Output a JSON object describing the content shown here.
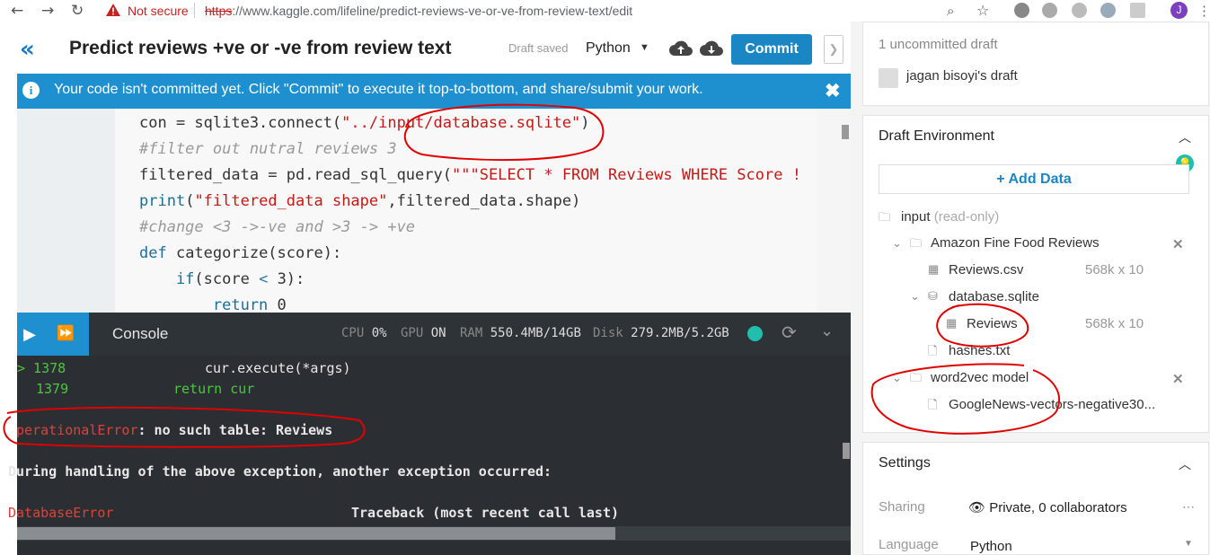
{
  "browser": {
    "security_text": "Not secure",
    "url_scheme": "https",
    "url_rest": "://www.kaggle.com/lifeline/predict-reviews-ve-or-ve-from-review-text/edit",
    "user_initial": "J"
  },
  "header": {
    "title": "Predict reviews +ve or -ve from review text",
    "draft_status": "Draft saved",
    "language": "Python",
    "commit_label": "Commit"
  },
  "banner": {
    "text": "Your code isn't committed yet. Click \"Commit\" to execute it top-to-bottom, and share/submit your work."
  },
  "code_lines": [
    [
      {
        "t": "con = sqlite3.connect(",
        "c": ""
      },
      {
        "t": "\"../input/database.sqlite\"",
        "c": "str"
      },
      {
        "t": ")",
        "c": ""
      }
    ],
    [
      {
        "t": "#filter out nutral reviews 3",
        "c": "cmt"
      }
    ],
    [
      {
        "t": "filtered_data = pd.read_sql_query(",
        "c": ""
      },
      {
        "t": "\"\"\"SELECT * FROM Reviews WHERE Score !",
        "c": "str"
      }
    ],
    [
      {
        "t": "print",
        "c": "kw"
      },
      {
        "t": "(",
        "c": ""
      },
      {
        "t": "\"filtered_data shape\"",
        "c": "str"
      },
      {
        "t": ",filtered_data.shape)",
        "c": ""
      }
    ],
    [
      {
        "t": "#change <3 ->-ve and >3 -> +ve",
        "c": "cmt"
      }
    ],
    [
      {
        "t": "def",
        "c": "kw"
      },
      {
        "t": " categorize(score):",
        "c": ""
      }
    ],
    [
      {
        "t": "    if",
        "c": "kw"
      },
      {
        "t": "(score ",
        "c": ""
      },
      {
        "t": "<",
        "c": "op"
      },
      {
        "t": " 3):",
        "c": ""
      }
    ],
    [
      {
        "t": "        return",
        "c": "kw"
      },
      {
        "t": " 0",
        "c": ""
      }
    ]
  ],
  "console": {
    "title": "Console",
    "cpu_label": "CPU",
    "cpu_value": "0%",
    "gpu_label": "GPU",
    "gpu_value": "ON",
    "ram_label": "RAM",
    "ram_value": "550.4MB/14GB",
    "disk_label": "Disk",
    "disk_value": "279.2MB/5.2GB",
    "lines": {
      "l1_arrow": "> 1378",
      "l1_code": "cur.execute(*args)",
      "l2_num": "1379",
      "l2_code": "return cur",
      "err_name": "OperationalError",
      "err_msg": ": no such table: Reviews",
      "during": "During handling of the above exception, another exception occurred:",
      "db_err": "DatabaseError",
      "traceback": "Traceback (most recent call last)"
    }
  },
  "sidebar": {
    "uncommitted": "1 uncommitted draft",
    "draft_owner": "jagan bisoyi's draft",
    "env_title": "Draft Environment",
    "add_data": "Add Data",
    "input_label": "input",
    "input_readonly": "(read-only)",
    "dataset1": "Amazon Fine Food Reviews",
    "reviews_csv": "Reviews.csv",
    "reviews_csv_size": "568k x 10",
    "database_sqlite": "database.sqlite",
    "reviews_table": "Reviews",
    "reviews_table_size": "568k x 10",
    "hashes": "hashes.txt",
    "dataset2": "word2vec model",
    "googlenews": "GoogleNews-vectors-negative30...",
    "settings_title": "Settings",
    "sharing_label": "Sharing",
    "sharing_value": "Private, 0 collaborators",
    "language_label": "Language",
    "language_value": "Python"
  },
  "colors": {
    "accent": "#1e8fcf",
    "commit": "#1a87c4",
    "error": "#e0403a",
    "ok": "#20beac",
    "annotation": "#e00000"
  }
}
